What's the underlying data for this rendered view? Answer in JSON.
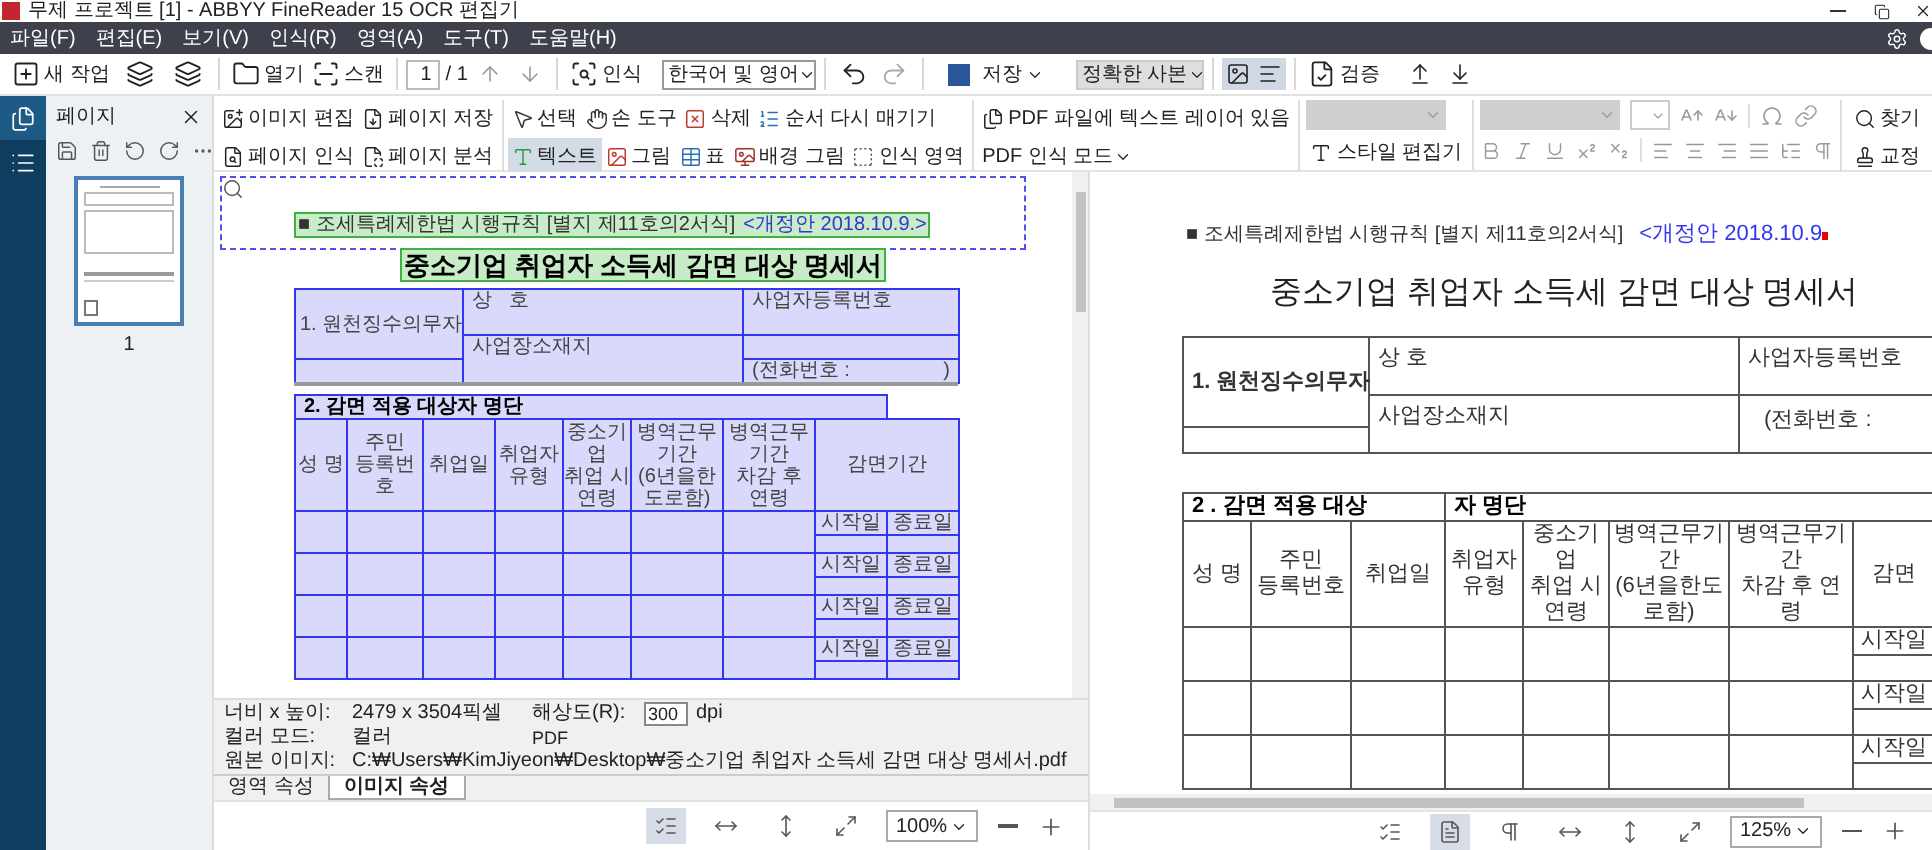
{
  "window": {
    "title": "무제 프로젝트 [1] - ABBYY FineReader 15 OCR 편집기"
  },
  "menu": [
    "파일(F)",
    "편집(E)",
    "보기(V)",
    "인식(R)",
    "영역(A)",
    "도구(T)",
    "도움말(H)"
  ],
  "toolbar": {
    "new_task": "새 작업",
    "open": "열기",
    "scan": "스캔",
    "page": "1",
    "page_total": "/ 1",
    "recognize": "인식",
    "language": "한국어 및 영어",
    "save": "저장",
    "save_format": "정확한 사본",
    "view_modes": [
      {
        "kind": "image",
        "selected": true
      },
      {
        "kind": "text",
        "selected": true
      }
    ],
    "verify": "검증"
  },
  "pages_panel": {
    "title": "페이지",
    "pages": [
      {
        "label": "1",
        "selected": true
      }
    ]
  },
  "image_tools": {
    "page_actions": [
      {
        "kind": "edit",
        "label": "이미지 편집"
      },
      {
        "kind": "save",
        "label": "페이지 저장"
      },
      {
        "kind": "recognize",
        "label": "페이지 인식"
      },
      {
        "kind": "analyze",
        "label": "페이지 분석"
      }
    ],
    "area_tools": [
      [
        {
          "kind": "select",
          "label": "선택",
          "selected": false
        },
        {
          "kind": "hand",
          "label": "손 도구",
          "selected": false
        },
        {
          "kind": "delete",
          "label": "삭제",
          "selected": false
        },
        {
          "kind": "reorder",
          "label": "순서 다시 매기기",
          "selected": false
        }
      ],
      [
        {
          "kind": "text",
          "label": "텍스트",
          "selected": true
        },
        {
          "kind": "picture",
          "label": "그림",
          "selected": false
        },
        {
          "kind": "table",
          "label": "표",
          "selected": false
        },
        {
          "kind": "background",
          "label": "배경 그림",
          "selected": false
        },
        {
          "kind": "recognition",
          "label": "인식 영역",
          "selected": false
        }
      ]
    ],
    "pdf_layer": "PDF 파일에 텍스트 레이어 있음",
    "pdf_mode": "PDF 인식 모드"
  },
  "text_tools": {
    "style_editor": "스타일 편집기",
    "find": "찾기",
    "proofread": "교정"
  },
  "image_doc": {
    "note": "■ 조세특례제한법 시행규칙 [별지 제11호의2서식]",
    "revision": "<개정안 2018.10.9.>",
    "title": "중소기업 취업자 소득세 감면 대상 명세서",
    "section1": {
      "label": "1. 원천징수의무자",
      "name": "상   호",
      "reg": "사업자등록번호",
      "addr": "사업장소재지",
      "phone": "(전화번호 :",
      "phone_end": ")"
    },
    "section2_title": [
      "2. 감면 적용 대상자 명단"
    ],
    "columns": [
      "성  명",
      "주민\n등록번호",
      "취업일",
      "취업자\n유형",
      "중소기업\n취업 시\n연령",
      "병역근무기간\n(6년을한도로함)",
      "병역근무기간\n차감 후 연령",
      "감면기간"
    ],
    "rows": [
      {
        "start": "시작일",
        "end": "종료일"
      },
      {
        "start": "시작일",
        "end": "종료일"
      },
      {
        "start": "시작일",
        "end": "종료일"
      },
      {
        "start": "시작일",
        "end": "종료일"
      }
    ]
  },
  "properties": {
    "size_label": "너비 x 높이:",
    "size": "2479 x 3504픽셀",
    "resolution_label": "해상도(R):",
    "resolution": "300",
    "dpi": "dpi",
    "color_label": "컬러 모드:",
    "color_mode": "컬러",
    "format": "PDF",
    "source_label": "원본 이미지:",
    "source": "C:₩Users₩KimJiyeon₩Desktop₩중소기업 취업자 소득세 감면 대상 명세서.pdf"
  },
  "property_tabs": [
    {
      "label": "영역 속성",
      "selected": false
    },
    {
      "label": "이미지 속성",
      "selected": true
    }
  ],
  "image_bottom": {
    "views": [
      {
        "kind": "list",
        "selected": true
      },
      {
        "kind": "fit-width",
        "selected": false
      },
      {
        "kind": "fit-height",
        "selected": false
      },
      {
        "kind": "fit-page",
        "selected": false
      }
    ],
    "zoom": "100%"
  },
  "text_doc": {
    "note": "■ 조세특례제한법 시행규칙 [별지 제11호의2서식]",
    "revision": "<개정안 2018.10.9",
    "title": "중소기업 취업자 소득세 감면 대상 명세서",
    "section1": {
      "label": "1. 원천징수의무자",
      "name": "상 호",
      "reg": "사업자등록번호",
      "addr": "사업장소재지",
      "phone": "(전화번호 :"
    },
    "section2_title": [
      "2 . 감면 적용 대상",
      "자 명단"
    ],
    "columns": [
      "성 명",
      "주민\n등록번호",
      "취업일",
      "취업자\n유형",
      "중소기업\n취업 시\n연령",
      "병역근무기간\n(6년을한도로함)",
      "병역근무기간\n차감 후 연령",
      "감면"
    ],
    "rows": [
      {
        "start": "시작일"
      },
      {
        "start": "시작일"
      },
      {
        "start": "시작일"
      }
    ]
  },
  "text_bottom": {
    "views": [
      {
        "kind": "list",
        "selected": false
      },
      {
        "kind": "text",
        "selected": true
      },
      {
        "kind": "pilcrow",
        "selected": false
      },
      {
        "kind": "fit-width",
        "selected": false
      },
      {
        "kind": "fit-height",
        "selected": false
      },
      {
        "kind": "fit-page",
        "selected": false
      }
    ],
    "zoom": "125%"
  }
}
